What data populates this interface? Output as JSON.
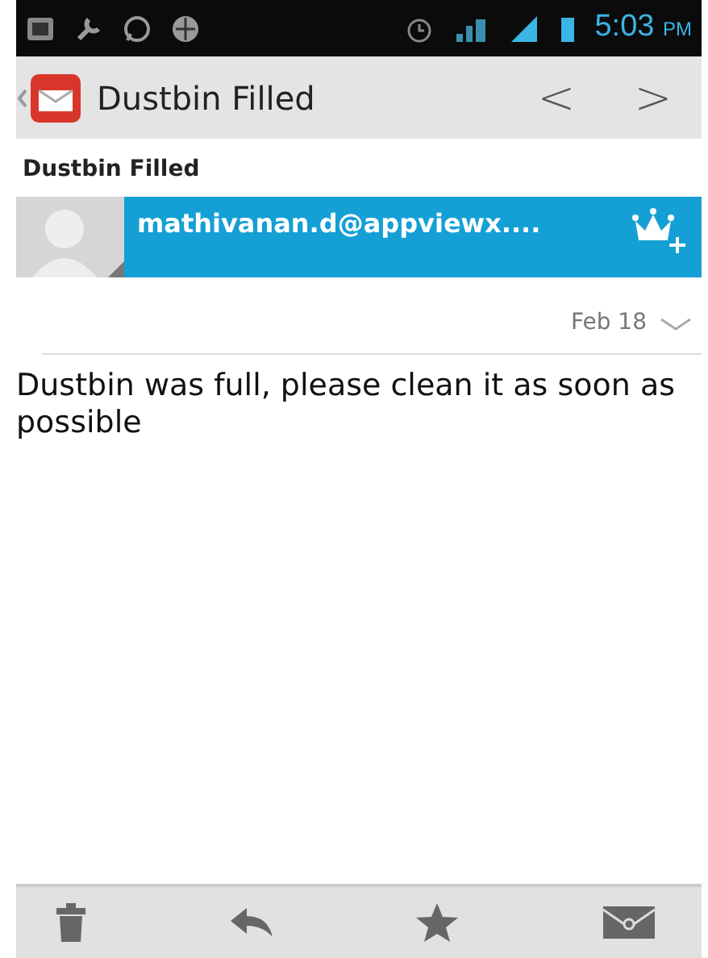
{
  "status_bar": {
    "time": "5:03",
    "ampm": "PM"
  },
  "action_bar": {
    "title": "Dustbin Filled",
    "prev": "<",
    "next": ">"
  },
  "subject": "Dustbin Filled",
  "sender": {
    "address": "mathivanan.d@appviewx...."
  },
  "date": "Feb 18",
  "body": "Dustbin was full, please clean it as soon as possible"
}
